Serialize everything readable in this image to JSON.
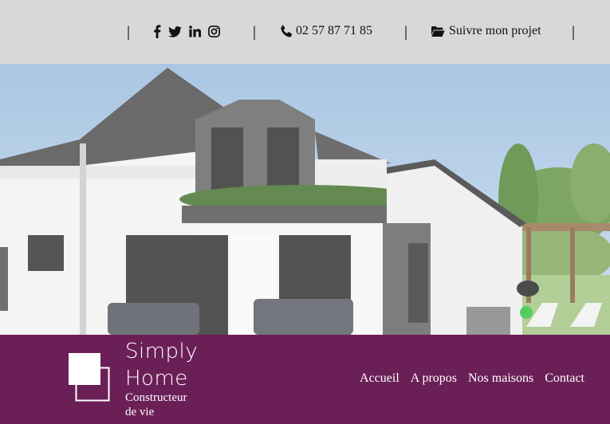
{
  "topbar": {
    "separator": "|",
    "social": [
      "facebook-icon",
      "twitter-icon",
      "linkedin-icon",
      "instagram-icon"
    ],
    "phone": {
      "icon": "phone-icon",
      "label": "02 57 87 71 85"
    },
    "project": {
      "icon": "folder-open-icon",
      "label": "Suivre mon projet"
    }
  },
  "footer": {
    "brand_line1": "Simply",
    "brand_line2": "Home",
    "tagline_line1": "Constructeur",
    "tagline_line2": "de vie",
    "nav": [
      "Accueil",
      "A propos",
      "Nos maisons",
      "Contact"
    ]
  },
  "colors": {
    "topbar_bg": "#d8d8d8",
    "footer_bg": "#6b1f57"
  }
}
